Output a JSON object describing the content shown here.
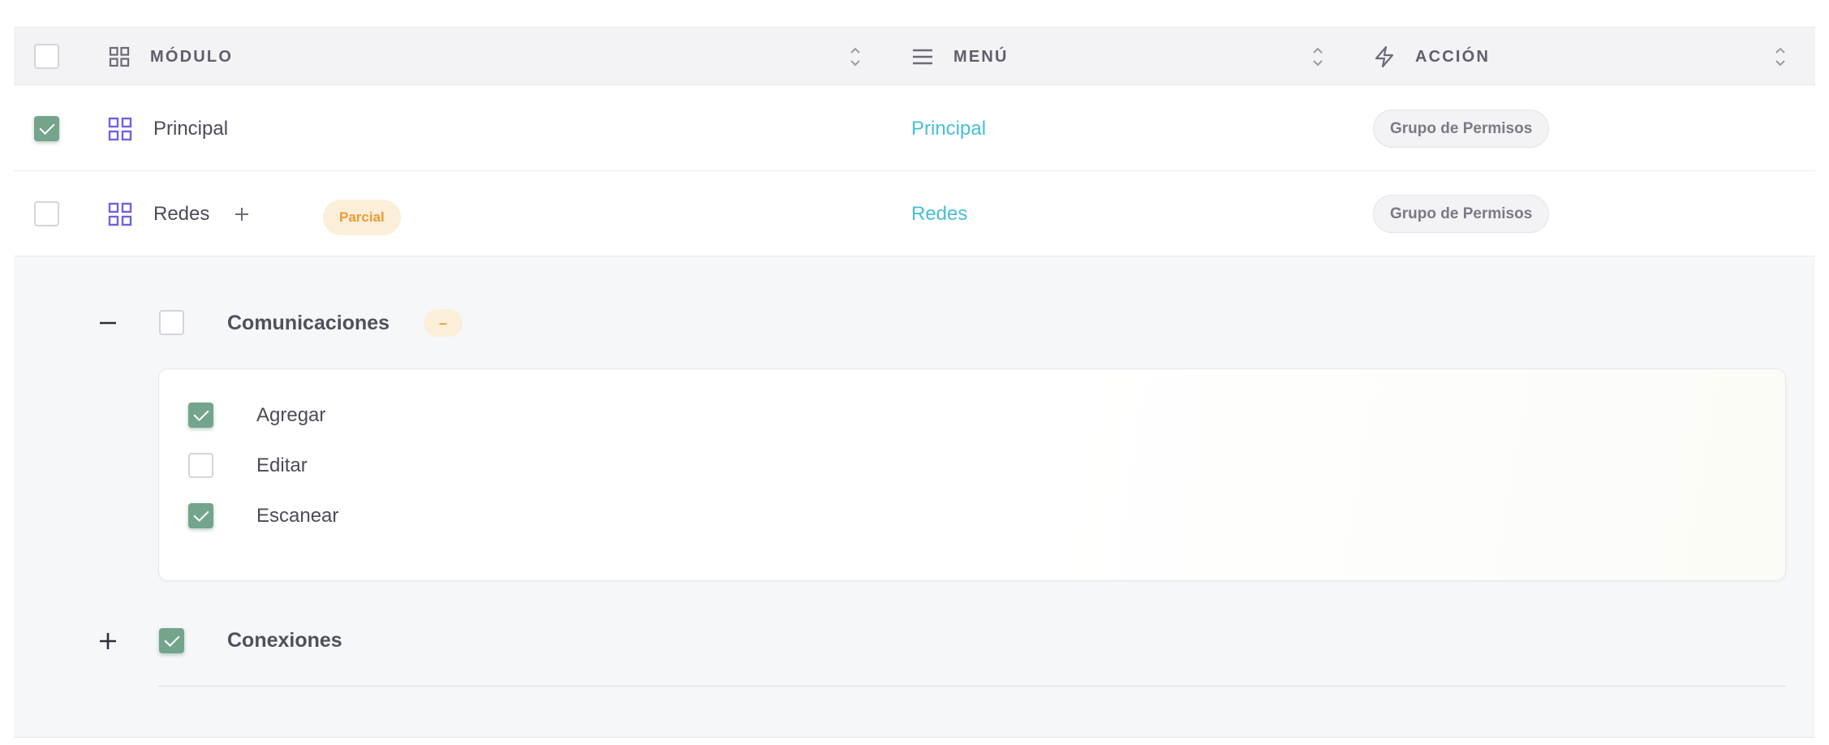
{
  "table": {
    "header": {
      "select_all_checked": false,
      "columns": [
        {
          "label": "MÓDULO",
          "icon": "grid-icon"
        },
        {
          "label": "MENÚ",
          "icon": "menu-lines-icon"
        },
        {
          "label": "ACCIÓN",
          "icon": "lightning-icon"
        }
      ]
    },
    "rows": [
      {
        "checked": true,
        "module": "Principal",
        "menu": "Principal",
        "action": "Grupo de Permisos"
      },
      {
        "checked": false,
        "module": "Redes",
        "badge": "Parcial",
        "menu": "Redes",
        "action": "Grupo de Permisos"
      }
    ]
  },
  "expanded": {
    "groups": [
      {
        "toggle": "–",
        "checked": false,
        "title": "Comunicaciones",
        "badge": "–",
        "permissions": [
          {
            "label": "Agregar",
            "checked": true
          },
          {
            "label": "Editar",
            "checked": false
          },
          {
            "label": "Escanear",
            "checked": true
          }
        ]
      },
      {
        "toggle": "+",
        "checked": true,
        "title": "Conexiones"
      }
    ]
  },
  "colors": {
    "accent_green": "#74a48c",
    "link_cyan": "#48bfd6",
    "grid_icon_purple": "#6d63e0",
    "partial_orange": "#ee9a36"
  }
}
